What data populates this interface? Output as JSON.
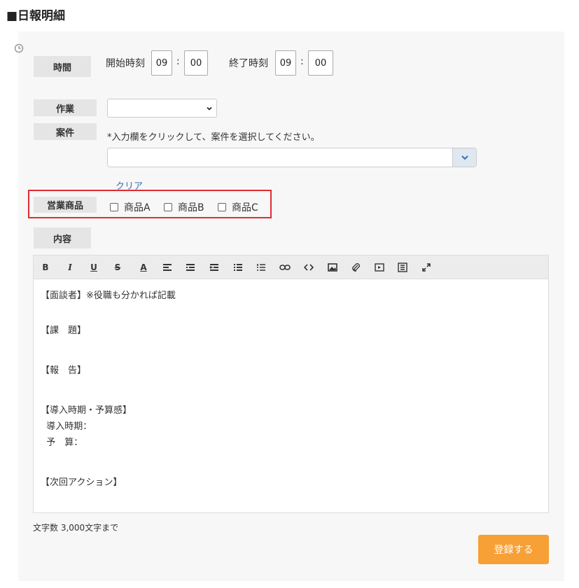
{
  "page_title": "■日報明細",
  "time": {
    "label": "時間",
    "start_label": "開始時刻",
    "start_hour": "09",
    "start_min": "00",
    "end_label": "終了時刻",
    "end_hour": "09",
    "end_min": "00",
    "colon": ":"
  },
  "work": {
    "label": "作業",
    "selected": ""
  },
  "case": {
    "label": "案件",
    "hint": "*入力欄をクリックして、案件を選択してください。",
    "value": "",
    "clear_label": "クリア"
  },
  "products": {
    "label": "営業商品",
    "options": [
      {
        "label": "商品A",
        "checked": false
      },
      {
        "label": "商品B",
        "checked": false
      },
      {
        "label": "商品C",
        "checked": false
      }
    ]
  },
  "content": {
    "label": "内容",
    "toolbar": [
      "bold",
      "italic",
      "underline",
      "strikethrough",
      "font-color",
      "align-left",
      "outdent",
      "indent",
      "bullet-list",
      "numbered-list",
      "link",
      "code",
      "image",
      "attachment",
      "video",
      "document",
      "fullscreen"
    ],
    "lines": [
      "【面談者】※役職も分かれば記載",
      "",
      "【課　題】",
      "",
      "",
      "【報　告】",
      "",
      "",
      "【導入時期・予算感】",
      "  導入時期：",
      "  予　算：",
      "",
      "",
      "【次回アクション】"
    ]
  },
  "char_limit": "文字数 3,000文字まで",
  "submit_label": "登録する",
  "colors": {
    "accent": "#f7a036",
    "highlight": "#e12b34",
    "link": "#3b6db3"
  }
}
